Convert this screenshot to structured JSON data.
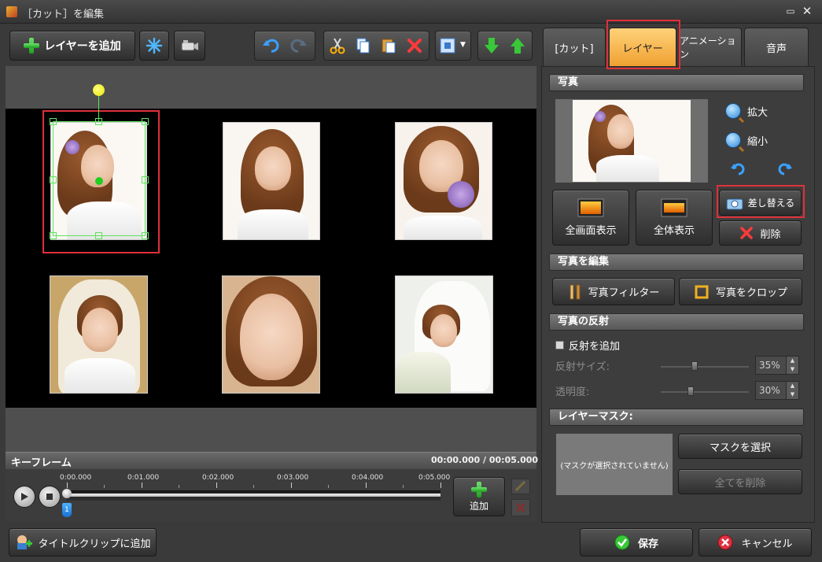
{
  "window": {
    "title": "［カット］を編集",
    "minimize_glyph": "▭",
    "close_glyph": "✕"
  },
  "toolbar": {
    "add_layer_label": "レイヤーを追加",
    "icons": [
      "effects-snowflake-icon",
      "camera-icon",
      "undo-icon",
      "redo-icon",
      "cut-icon",
      "copy-icon",
      "paste-icon",
      "delete-icon",
      "fit-icon",
      "dropdown-icon",
      "move-down-icon",
      "move-up-icon"
    ]
  },
  "canvas": {
    "photos": [
      "photo-1",
      "photo-2",
      "photo-3",
      "photo-4",
      "photo-5",
      "photo-6"
    ]
  },
  "keyframe": {
    "title": "キーフレーム",
    "time_current": "00:00.000",
    "time_separator": "/",
    "time_total": "00:05.000",
    "ticks": [
      "0:00.000",
      "0:01.000",
      "0:02.000",
      "0:03.000",
      "0:04.000",
      "0:05.000"
    ],
    "marker_number": "1",
    "add_label": "追加"
  },
  "tabs": [
    "[カット]",
    "レイヤー",
    "アニメーション",
    "音声"
  ],
  "active_tab_index": 1,
  "photo_section": {
    "title": "写真",
    "zoom_in": "拡大",
    "zoom_out": "縮小",
    "fullscreen": "全画面表示",
    "fit_all": "全体表示",
    "replace": "差し替える",
    "delete": "削除"
  },
  "edit_section": {
    "title": "写真を編集",
    "filter": "写真フィルター",
    "crop": "写真をクロップ"
  },
  "reflection_section": {
    "title": "写真の反射",
    "add_reflection": "反射を追加",
    "size_label": "反射サイズ:",
    "size_value": "35%",
    "size_fraction": 0.35,
    "opacity_label": "透明度:",
    "opacity_value": "30%",
    "opacity_fraction": 0.3
  },
  "mask_section": {
    "title": "レイヤーマスク:",
    "empty_text": "(マスクが選択されていません)",
    "select_mask": "マスクを選択",
    "clear_all": "全てを削除"
  },
  "footer": {
    "add_title_clip": "タイトルクリップに追加",
    "save": "保存",
    "cancel": "キャンセル"
  },
  "colors": {
    "accent_tab": "#f0a030",
    "highlight": "#e0303a",
    "selection": "#5ee35e"
  }
}
